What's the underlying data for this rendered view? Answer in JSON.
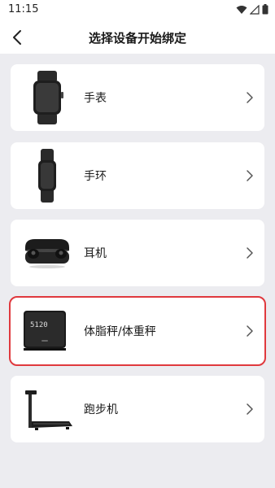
{
  "status_bar": {
    "time": "11:15"
  },
  "nav": {
    "title": "选择设备开始绑定"
  },
  "devices": [
    {
      "label": "手表",
      "icon": "smartwatch-icon"
    },
    {
      "label": "手环",
      "icon": "fitness-band-icon"
    },
    {
      "label": "耳机",
      "icon": "earbuds-icon"
    },
    {
      "label": "体脂秤/体重秤",
      "icon": "body-scale-icon",
      "scale_reading": "5120"
    },
    {
      "label": "跑步机",
      "icon": "treadmill-icon"
    }
  ],
  "colors": {
    "selected_border": "#e0393e",
    "background": "#ececf0",
    "card": "#ffffff"
  }
}
